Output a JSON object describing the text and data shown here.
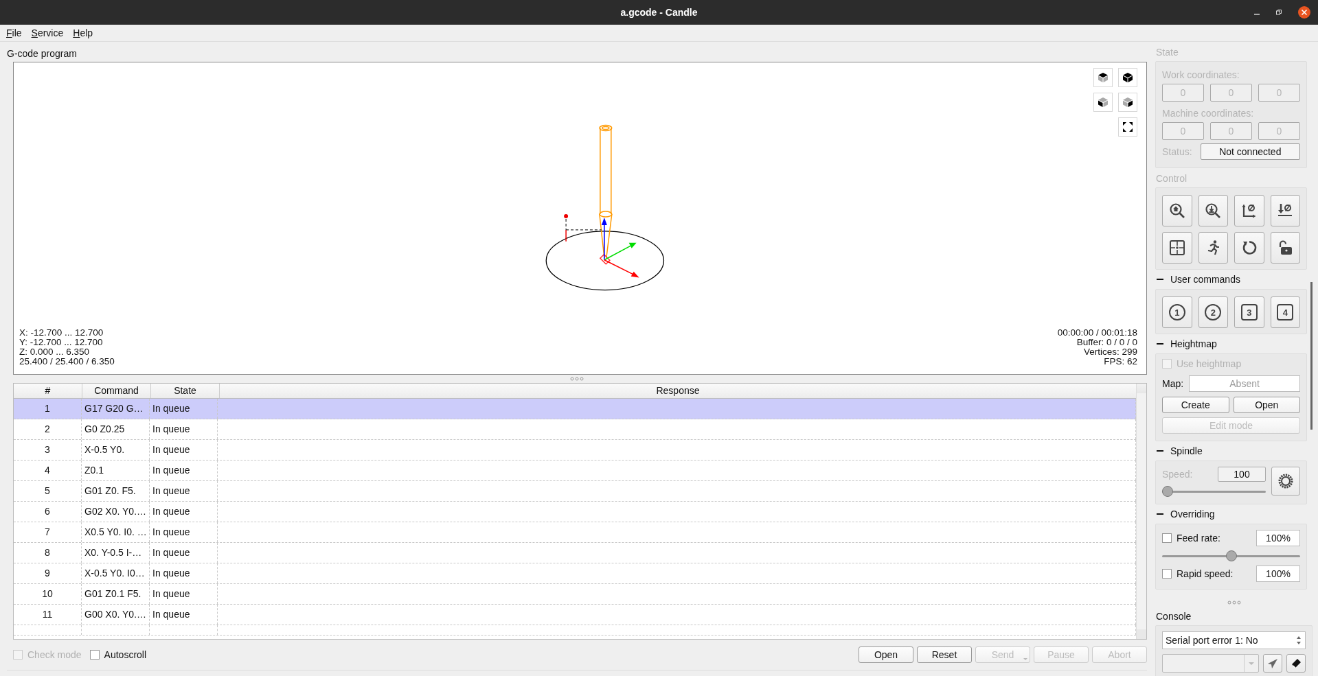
{
  "window": {
    "title": "a.gcode - Candle"
  },
  "menu": [
    {
      "label": "File"
    },
    {
      "label": "Service"
    },
    {
      "label": "Help"
    }
  ],
  "program": {
    "title": "G-code program",
    "bounds": [
      "X: -12.700 ... 12.700",
      "Y: -12.700 ... 12.700",
      "Z: 0.000 ... 6.350",
      "25.400 / 25.400 / 6.350"
    ],
    "stats": [
      "00:00:00 / 00:01:18",
      "Buffer: 0 / 0 / 0",
      "Vertices: 299",
      "FPS: 62"
    ]
  },
  "table": {
    "columns": [
      "#",
      "Command",
      "State",
      "Response"
    ],
    "rows": [
      {
        "number": "1",
        "command": "G17 G20 G…",
        "state": "In queue",
        "selected": true
      },
      {
        "number": "2",
        "command": "G0 Z0.25",
        "state": "In queue",
        "selected": false
      },
      {
        "number": "3",
        "command": "X-0.5 Y0.",
        "state": "In queue",
        "selected": false
      },
      {
        "number": "4",
        "command": "Z0.1",
        "state": "In queue",
        "selected": false
      },
      {
        "number": "5",
        "command": "G01 Z0. F5.",
        "state": "In queue",
        "selected": false
      },
      {
        "number": "6",
        "command": "G02 X0. Y0.…",
        "state": "In queue",
        "selected": false
      },
      {
        "number": "7",
        "command": "X0.5 Y0. I0. …",
        "state": "In queue",
        "selected": false
      },
      {
        "number": "8",
        "command": "X0. Y-0.5 I-…",
        "state": "In queue",
        "selected": false
      },
      {
        "number": "9",
        "command": "X-0.5 Y0. I0…",
        "state": "In queue",
        "selected": false
      },
      {
        "number": "10",
        "command": "G01 Z0.1 F5.",
        "state": "In queue",
        "selected": false
      },
      {
        "number": "11",
        "command": "G00 X0. Y0.…",
        "state": "In queue",
        "selected": false
      }
    ]
  },
  "options": [
    {
      "label": "Check mode",
      "checked": false,
      "disabled": true
    },
    {
      "label": "Autoscroll",
      "checked": false,
      "disabled": false
    }
  ],
  "buttons": [
    {
      "label": "Open",
      "disabled": false,
      "has_menu": false
    },
    {
      "label": "Reset",
      "disabled": false,
      "has_menu": false
    },
    {
      "label": "Send",
      "disabled": true,
      "has_menu": true
    },
    {
      "label": "Pause",
      "disabled": true,
      "has_menu": false
    },
    {
      "label": "Abort",
      "disabled": true,
      "has_menu": false
    }
  ],
  "state": {
    "title": "State",
    "disabled": true,
    "work_label": "Work coordinates:",
    "work": [
      "0",
      "0",
      "0"
    ],
    "machine_label": "Machine coordinates:",
    "machine": [
      "0",
      "0",
      "0"
    ],
    "status_label": "Status:",
    "status": "Not connected"
  },
  "control": {
    "title": "Control",
    "disabled": true
  },
  "user_commands": {
    "title": "User commands",
    "expanded": true,
    "buttons": [
      {
        "label": "1",
        "kind": "circle"
      },
      {
        "label": "2",
        "kind": "circle"
      },
      {
        "label": "3",
        "kind": "square"
      },
      {
        "label": "4",
        "kind": "square"
      }
    ]
  },
  "heightmap": {
    "title": "Heightmap",
    "expanded": true,
    "use": {
      "label": "Use heightmap",
      "checked": false,
      "disabled": true
    },
    "map_label": "Map:",
    "map": "Absent",
    "buttons": [
      {
        "label": "Create",
        "disabled": false
      },
      {
        "label": "Open",
        "disabled": false
      },
      {
        "label": "Edit mode",
        "disabled": true
      }
    ]
  },
  "spindle": {
    "title": "Spindle",
    "expanded": true,
    "speed_label": "Speed:",
    "speed_disabled": true,
    "speed": "100",
    "level": 0.0
  },
  "overriding": {
    "title": "Overriding",
    "expanded": true,
    "items": [
      {
        "label": "Feed rate:",
        "checked": false,
        "value": "100%",
        "level": 0.5
      },
      {
        "label": "Rapid speed:",
        "checked": false,
        "value": "100%"
      }
    ]
  },
  "console": {
    "title": "Console",
    "log": "Serial port error 1: No"
  }
}
